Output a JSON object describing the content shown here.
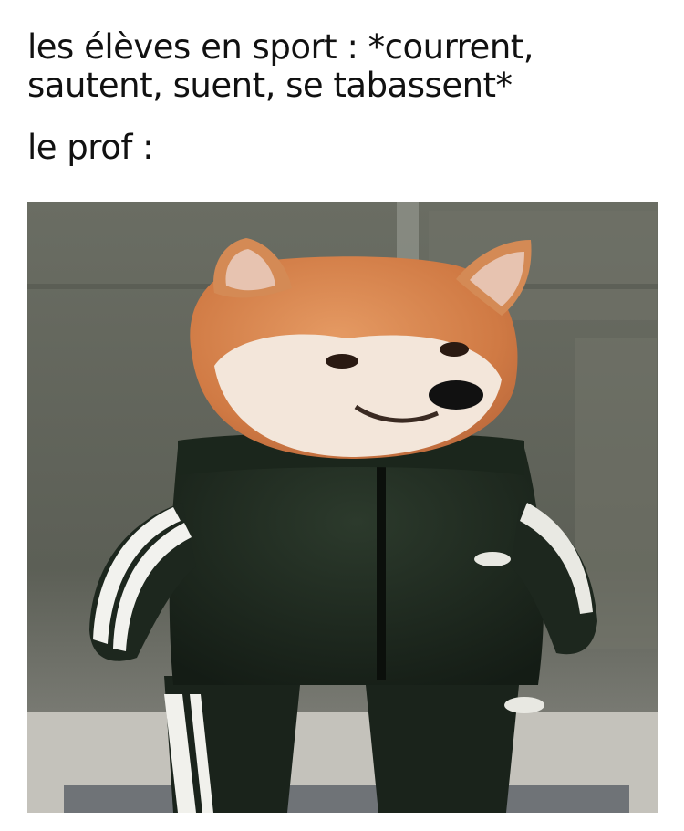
{
  "caption": {
    "line1": "les élèves en sport : *courrent,",
    "line2": "sautent, suent, se tabassent*",
    "line3": "le prof :"
  },
  "photo": {
    "subject": "shiba-inu-dog-in-black-tracksuit",
    "colors": {
      "background_wall": "#5f6259",
      "door_panel": "#6e7166",
      "floor": "#c9c7c0",
      "fur_orange": "#d9874f",
      "fur_cream": "#f3e6da",
      "tracksuit": "#1f2a20",
      "stripes": "#f2f2ee"
    }
  }
}
